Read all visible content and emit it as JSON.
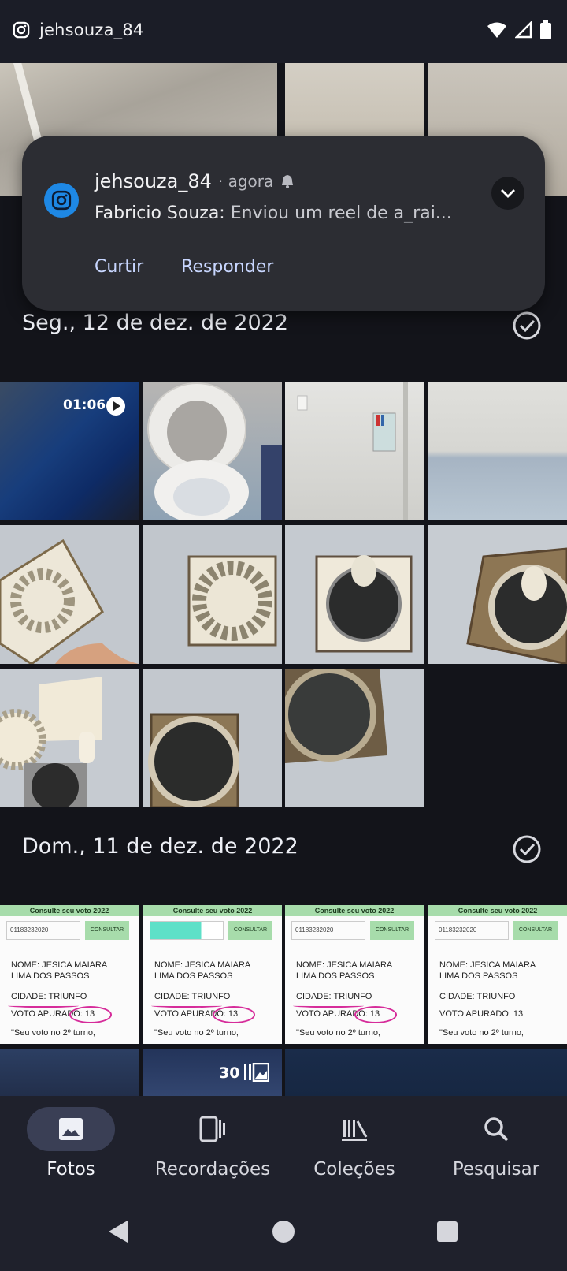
{
  "status_bar": {
    "title": "jehsouza_84",
    "left_icon": "instagram-icon",
    "right_icons": [
      "wifi-icon",
      "signal-icon",
      "battery-icon"
    ]
  },
  "notification": {
    "app_icon": "instagram-icon",
    "username": "jehsouza_84",
    "time": "· agora",
    "sender": "Fabricio Souza:",
    "message": " Enviou um reel de a_rai...",
    "actions": {
      "like": "Curtir",
      "reply": "Responder"
    }
  },
  "sections": [
    {
      "date": "Seg., 12 de dez. de 2022"
    },
    {
      "date": "Dom., 11 de dez. de 2022"
    }
  ],
  "video_duration": "01:06",
  "album_count": "30",
  "ballot": {
    "header": "Consulte seu voto 2022",
    "input_value": "01183232020",
    "button": "CONSULTAR",
    "name_line1": "NOME: JESICA MAIARA",
    "name_line2": "LIMA DOS PASSOS",
    "city": "CIDADE: TRIUNFO",
    "vote": "VOTO APURADO: 13",
    "quote": "\"Seu voto no 2º turno,"
  },
  "bottom_nav": [
    {
      "label": "Fotos",
      "icon": "photo-icon",
      "active": true
    },
    {
      "label": "Recordações",
      "icon": "memories-icon",
      "active": false
    },
    {
      "label": "Coleções",
      "icon": "library-icon",
      "active": false
    },
    {
      "label": "Pesquisar",
      "icon": "search-icon",
      "active": false
    }
  ],
  "system_nav": [
    "back-icon",
    "home-icon",
    "recents-icon"
  ],
  "colors": {
    "background": "#13141a",
    "notification": "#2c2d33",
    "accent_action": "#c8d6ff",
    "nav_active_pill": "#3a3f55",
    "instagram_blue": "#1e88e5"
  }
}
